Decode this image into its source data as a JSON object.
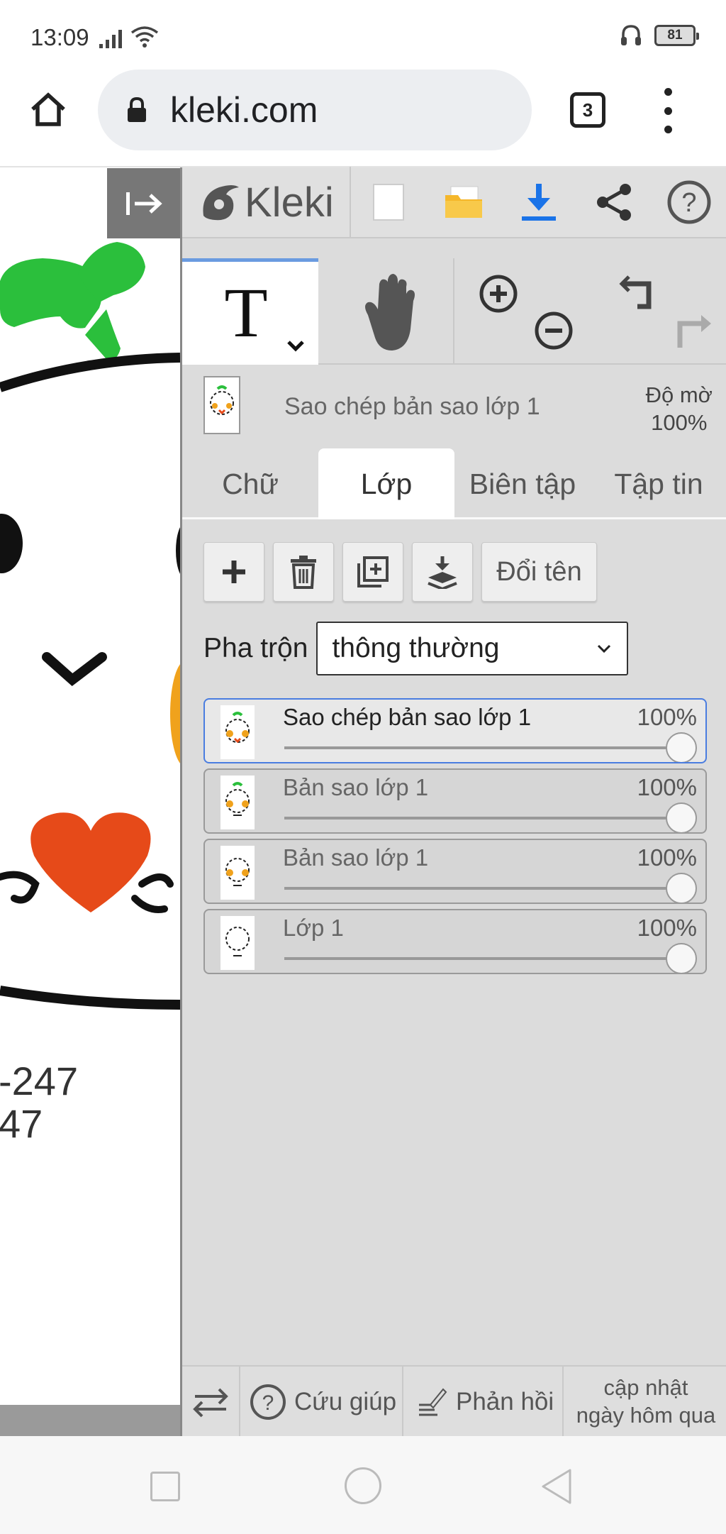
{
  "status_bar": {
    "time": "13:09",
    "battery": "81"
  },
  "browser": {
    "url": "kleki.com",
    "tab_count": "3"
  },
  "canvas": {
    "numbers": [
      "-247",
      "47"
    ]
  },
  "app": {
    "logo": "Kleki",
    "current_layer": "Sao chép bản sao lớp 1",
    "opacity_label": "Độ mờ",
    "opacity_value": "100%",
    "tabs": [
      "Chữ",
      "Lớp",
      "Biên tập",
      "Tập tin"
    ],
    "active_tab": "Lớp",
    "rename_label": "Đổi tên",
    "blend_label": "Pha trộn",
    "blend_value": "thông thường",
    "layers": [
      {
        "name": "Sao chép bản sao lớp 1",
        "opacity": "100%",
        "active": true
      },
      {
        "name": "Bản sao lớp 1",
        "opacity": "100%",
        "active": false
      },
      {
        "name": "Bản sao lớp 1",
        "opacity": "100%",
        "active": false
      },
      {
        "name": "Lớp 1",
        "opacity": "100%",
        "active": false
      }
    ],
    "footer": {
      "help": "Cứu giúp",
      "feedback": "Phản hồi",
      "update_line1": "cập nhật",
      "update_line2": "ngày hôm qua"
    }
  },
  "colors": {
    "accent_blue": "#1a73e8",
    "folder_yellow": "#f5b72a",
    "layer_active_border": "#4a7de0"
  }
}
